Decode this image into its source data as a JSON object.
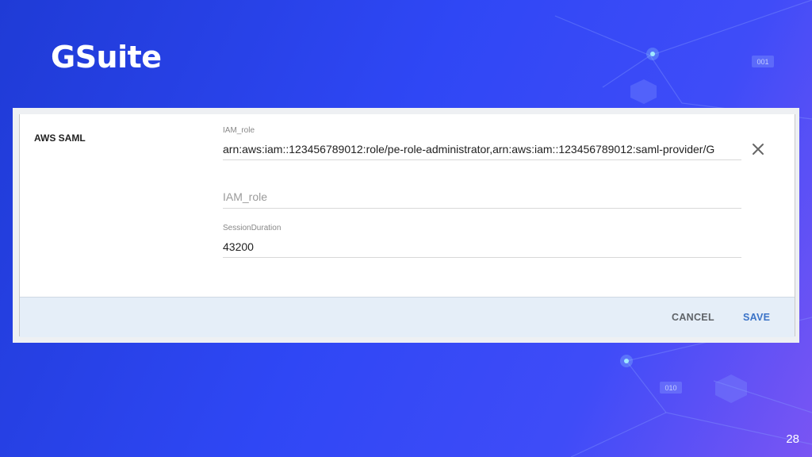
{
  "brand": "GSuite",
  "slide_number": "28",
  "decorations": {
    "tag_top": "001",
    "tag_bottom": "010"
  },
  "panel": {
    "section_title": "AWS SAML",
    "fields": [
      {
        "label": "IAM_role",
        "value": "arn:aws:iam::123456789012:role/pe-role-administrator,arn:aws:iam::123456789012:saml-provider/G"
      },
      {
        "placeholder": "IAM_role"
      },
      {
        "label": "SessionDuration",
        "value": "43200"
      }
    ],
    "actions": {
      "cancel": "CANCEL",
      "save": "SAVE"
    }
  },
  "colors": {
    "accent": "#3b73c7",
    "footer_bg": "#e5eef8",
    "bg_start": "#1f3bd6",
    "bg_end": "#7a55f3"
  }
}
